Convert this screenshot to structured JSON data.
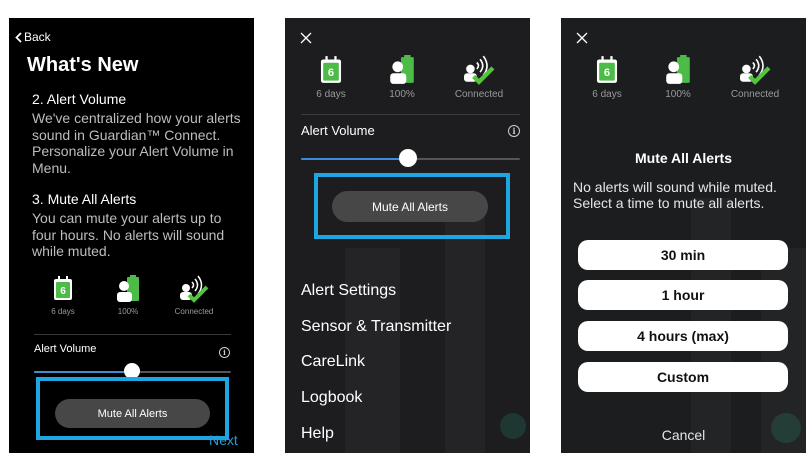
{
  "colors": {
    "highlight": "#1da6e0",
    "slider_fill": "#3d8bd9",
    "next_link": "#2a9ad8",
    "sensor_green": "#4cbb47",
    "connected_check": "#54c43f"
  },
  "status": {
    "sensor_days_number": "6",
    "sensor_days_label": "6 days",
    "battery_label": "100%",
    "connection_label": "Connected",
    "icons": [
      "calendar-sensor-icon",
      "transmitter-battery-icon",
      "connected-phone-icon"
    ]
  },
  "slider": {
    "volume_fraction": 0.48
  },
  "whats_new": {
    "back_label": "Back",
    "title": "What's New",
    "section1_title": "2. Alert Volume",
    "section1_body": "We've centralized how your alerts\nsound in Guardian™ Connect.\nPersonalize your Alert Volume in\nMenu.",
    "section2_title": "3. Mute All Alerts",
    "section2_body": "You can mute your alerts up to\nfour hours. No alerts will sound\nwhile muted.",
    "alert_volume_label": "Alert Volume",
    "mute_button": "Mute All Alerts",
    "next_label": "Next"
  },
  "menu": {
    "alert_volume_label": "Alert Volume",
    "mute_button": "Mute All Alerts",
    "items": [
      "Alert Settings",
      "Sensor & Transmitter",
      "CareLink",
      "Logbook",
      "Help"
    ]
  },
  "mute_dialog": {
    "title": "Mute All Alerts",
    "body": "No alerts will sound while muted.\nSelect a time to mute all alerts.",
    "options": [
      "30 min",
      "1 hour",
      "4 hours (max)",
      "Custom"
    ],
    "cancel_label": "Cancel"
  }
}
